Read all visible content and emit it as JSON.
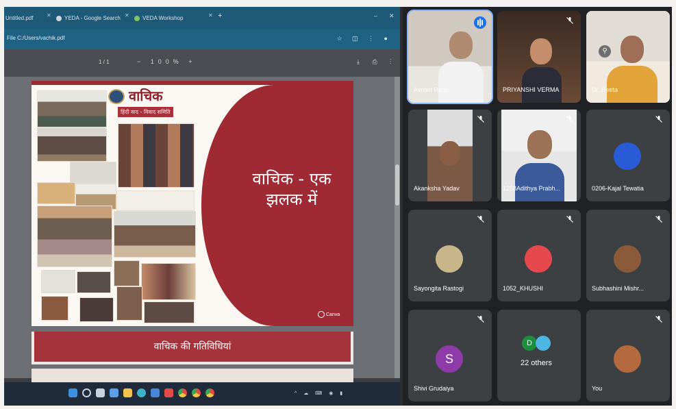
{
  "browser": {
    "tabs": [
      {
        "label": "Untitled.pdf"
      },
      {
        "label": "YEDA - Google Search"
      },
      {
        "label": "VEDA Workshop"
      }
    ],
    "url": "File C:/Users/vachik.pdf",
    "pdf_page": "1 / 1",
    "pdf_zoom": "−  100%  +"
  },
  "slide": {
    "logo_title": "वाचिक",
    "logo_subtitle": "हिंदी वाद - विवाद समिति",
    "title_line1": "वाचिक - एक",
    "title_line2": "झलक में",
    "brand": "Canva"
  },
  "slide2": {
    "title": "वाचिक की गतिविधियां"
  },
  "participants": [
    {
      "name": "Avnish Rana",
      "speaking": true
    },
    {
      "name": "PRIYANSHI VERMA",
      "mic_off": true
    },
    {
      "name": "Dr. Reeta",
      "pinned": true
    },
    {
      "name": "Akanksha Yadav",
      "mic_off": true
    },
    {
      "name": "1258Adithya Prabh...",
      "mic_off": true
    },
    {
      "name": "0206-Kajal Tewatia",
      "mic_off": true
    },
    {
      "name": "Sayongita Rastogi",
      "mic_off": true
    },
    {
      "name": "1052_KHUSHI",
      "mic_off": true
    },
    {
      "name": "Subhashini Mishr...",
      "mic_off": true
    },
    {
      "name": "Shivi Grudaiya",
      "mic_off": true,
      "initial": "S"
    },
    {
      "name": "22 others",
      "initial": "D"
    },
    {
      "name": "You",
      "mic_off": true
    }
  ],
  "colors": {
    "slide_red": "#9f2a34",
    "meet_bg": "#202124",
    "tile_bg": "#3c4043",
    "speaking_blue": "#8ab4f8"
  }
}
